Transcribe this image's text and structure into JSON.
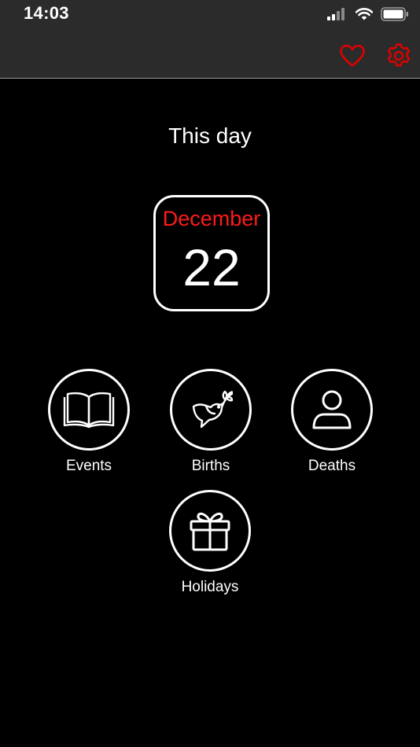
{
  "status_bar": {
    "time": "14:03",
    "icons": [
      "cellular-signal-icon",
      "wifi-icon",
      "battery-icon"
    ]
  },
  "nav": {
    "icons": [
      "heart-icon",
      "gear-icon"
    ],
    "accent_color": "#e00000"
  },
  "page": {
    "title": "This day"
  },
  "date_card": {
    "month": "December",
    "day": "22",
    "month_color": "#ff1a1a"
  },
  "categories": [
    {
      "label": "Events",
      "icon": "open-book-icon"
    },
    {
      "label": "Births",
      "icon": "dove-icon"
    },
    {
      "label": "Deaths",
      "icon": "person-icon"
    },
    {
      "label": "Holidays",
      "icon": "gift-icon"
    }
  ]
}
